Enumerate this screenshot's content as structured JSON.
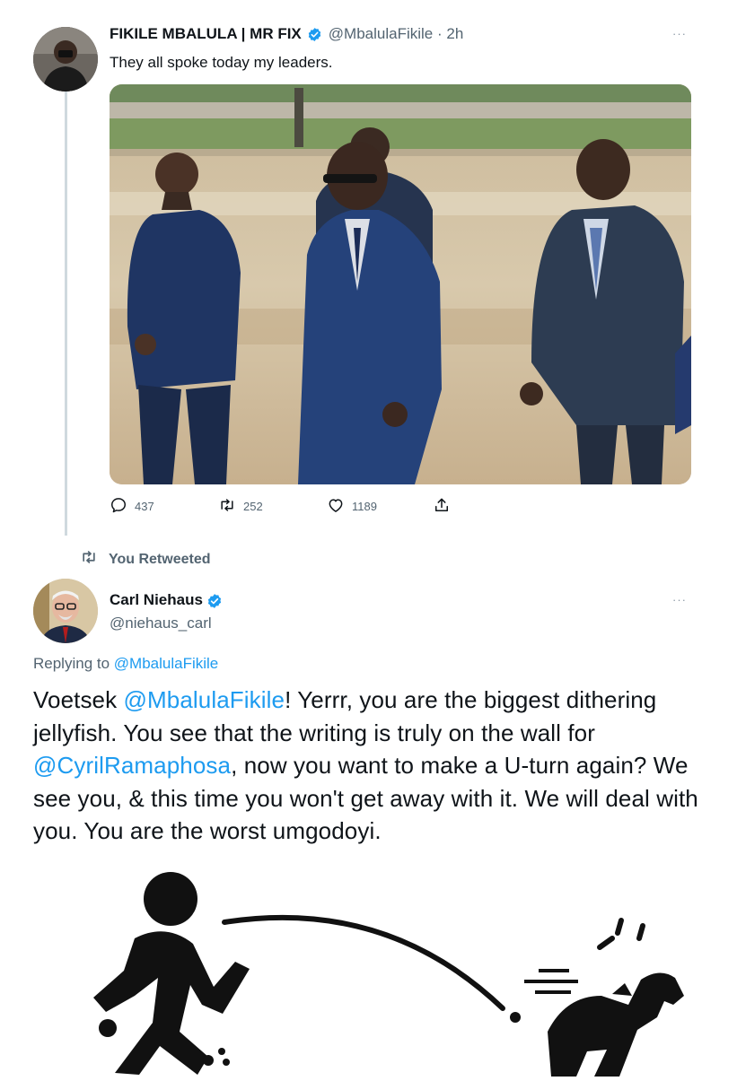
{
  "tweet1": {
    "display_name": "FIKILE MBALULA | MR FIX",
    "handle": "@MbalulaFikile",
    "separator": "·",
    "time": "2h",
    "text": "They all spoke today my leaders.",
    "more": "···",
    "stats": {
      "replies": "437",
      "retweets": "252",
      "likes": "1189"
    }
  },
  "retweet_notice": "You Retweeted",
  "tweet2": {
    "display_name": "Carl Niehaus",
    "handle": "@niehaus_carl",
    "more": "···",
    "replying_label": "Replying to",
    "replying_to": "@MbalulaFikile",
    "body": {
      "w1": "Voetsek",
      "m1": "@MbalulaFikile",
      "t1": "! Yerrr, you are the biggest dithering jellyfish. You see that the writing is truly on the wall for",
      "m2": "@CyrilRamaphosa",
      "t2": ", now you want to make a U-turn again? We see you, & this time you won't get away with it. We will deal with you. You are the worst umgodoyi."
    }
  },
  "colors": {
    "accent": "#1d9bf0",
    "verified": "#1d9bf0",
    "muted": "#536471"
  },
  "icons": [
    "reply-icon",
    "retweet-icon",
    "like-icon",
    "share-icon",
    "verified-icon",
    "retweeted-icon"
  ]
}
